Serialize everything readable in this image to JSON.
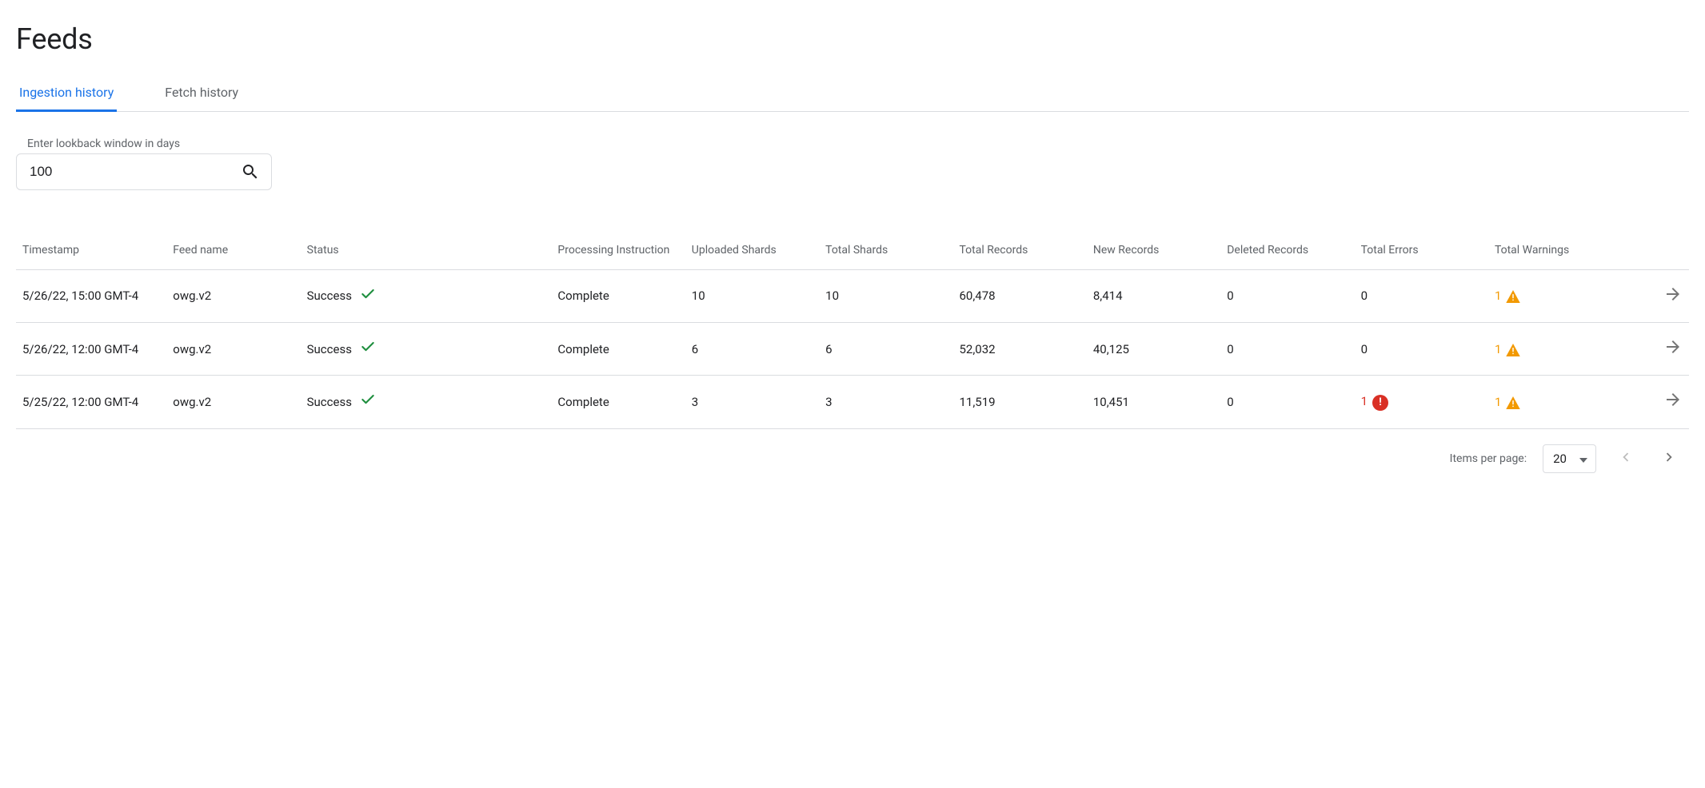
{
  "title": "Feeds",
  "tabs": [
    {
      "label": "Ingestion history",
      "active": true
    },
    {
      "label": "Fetch history",
      "active": false
    }
  ],
  "lookback": {
    "label": "Enter lookback window in days",
    "value": "100"
  },
  "columns": [
    "Timestamp",
    "Feed name",
    "Status",
    "Processing Instruction",
    "Uploaded Shards",
    "Total Shards",
    "Total Records",
    "New Records",
    "Deleted Records",
    "Total Errors",
    "Total Warnings"
  ],
  "rows": [
    {
      "timestamp": "5/26/22, 15:00 GMT-4",
      "feed_name": "owg.v2",
      "status": "Success",
      "processing_instruction": "Complete",
      "uploaded_shards": "10",
      "total_shards": "10",
      "total_records": "60,478",
      "new_records": "8,414",
      "deleted_records": "0",
      "total_errors": "0",
      "has_error_badge": false,
      "total_warnings": "1",
      "has_warning_badge": true
    },
    {
      "timestamp": "5/26/22, 12:00 GMT-4",
      "feed_name": "owg.v2",
      "status": "Success",
      "processing_instruction": "Complete",
      "uploaded_shards": "6",
      "total_shards": "6",
      "total_records": "52,032",
      "new_records": "40,125",
      "deleted_records": "0",
      "total_errors": "0",
      "has_error_badge": false,
      "total_warnings": "1",
      "has_warning_badge": true
    },
    {
      "timestamp": "5/25/22, 12:00 GMT-4",
      "feed_name": "owg.v2",
      "status": "Success",
      "processing_instruction": "Complete",
      "uploaded_shards": "3",
      "total_shards": "3",
      "total_records": "11,519",
      "new_records": "10,451",
      "deleted_records": "0",
      "total_errors": "1",
      "has_error_badge": true,
      "total_warnings": "1",
      "has_warning_badge": true
    }
  ],
  "pagination": {
    "items_per_page_label": "Items per page:",
    "items_per_page_value": "20",
    "prev_enabled": false,
    "next_enabled": true
  }
}
